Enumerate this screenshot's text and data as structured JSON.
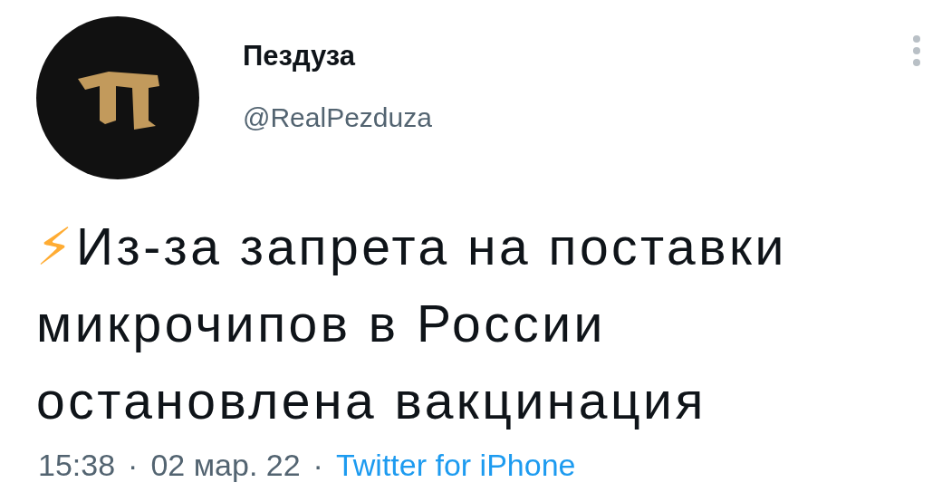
{
  "author": {
    "name": "Пездуза",
    "handle": "@RealPezduza"
  },
  "tweet": {
    "emoji": "⚡",
    "text": "Из-за запрета на поставки микрочипов в России остановлена вакцинация"
  },
  "footer": [
    {
      "kind": "plain",
      "text": "15:38"
    },
    {
      "kind": "separator",
      "text": "·"
    },
    {
      "kind": "plain",
      "text": "02 мар. 22"
    },
    {
      "kind": "separator",
      "text": "·"
    },
    {
      "kind": "link",
      "text": "Twitter for iPhone"
    }
  ]
}
